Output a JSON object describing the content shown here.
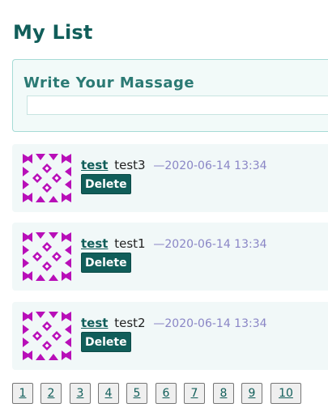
{
  "page": {
    "title": "My List"
  },
  "composer": {
    "title": "Write Your Massage",
    "input_value": "",
    "input_placeholder": ""
  },
  "posts": [
    {
      "author": "test",
      "text": "test3",
      "time": "—2020-06-14 13:34",
      "delete_label": "Delete",
      "avatar_icon": "identicon-avatar"
    },
    {
      "author": "test",
      "text": "test1",
      "time": "—2020-06-14 13:34",
      "delete_label": "Delete",
      "avatar_icon": "identicon-avatar"
    },
    {
      "author": "test",
      "text": "test2",
      "time": "—2020-06-14 13:34",
      "delete_label": "Delete",
      "avatar_icon": "identicon-avatar"
    }
  ],
  "pagination": {
    "pages": [
      "1",
      "2",
      "3",
      "4",
      "5",
      "6",
      "7",
      "8",
      "9",
      "10"
    ]
  },
  "colors": {
    "accent": "#115e5a",
    "avatar": "#b80fb8",
    "timestamp": "#8a86c6",
    "card_background": "#f1f8f8"
  }
}
